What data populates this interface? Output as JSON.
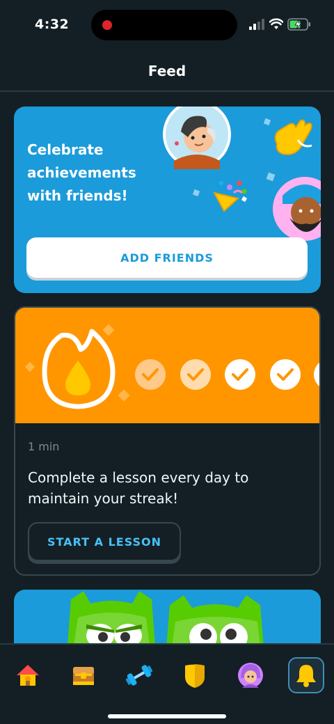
{
  "status_bar": {
    "time": "4:32"
  },
  "header": {
    "title": "Feed"
  },
  "friends_card": {
    "title": "Celebrate achievements with friends!",
    "button_label": "ADD FRIENDS"
  },
  "streak_card": {
    "duration": "1 min",
    "message": "Complete a lesson every day to maintain your streak!",
    "button_label": "START A LESSON",
    "checks_visible": 5
  },
  "nav": {
    "items": [
      {
        "icon": "home-icon"
      },
      {
        "icon": "treasure-chest-icon"
      },
      {
        "icon": "dumbbell-icon"
      },
      {
        "icon": "shield-icon"
      },
      {
        "icon": "profile-avatar-icon"
      },
      {
        "icon": "bell-icon",
        "active": true
      }
    ]
  },
  "colors": {
    "background": "#131f24",
    "friends_card": "#1b9bd9",
    "streak_banner": "#ff9600",
    "accent_blue": "#49c0f8",
    "active_nav_border": "#3f8fb6"
  }
}
